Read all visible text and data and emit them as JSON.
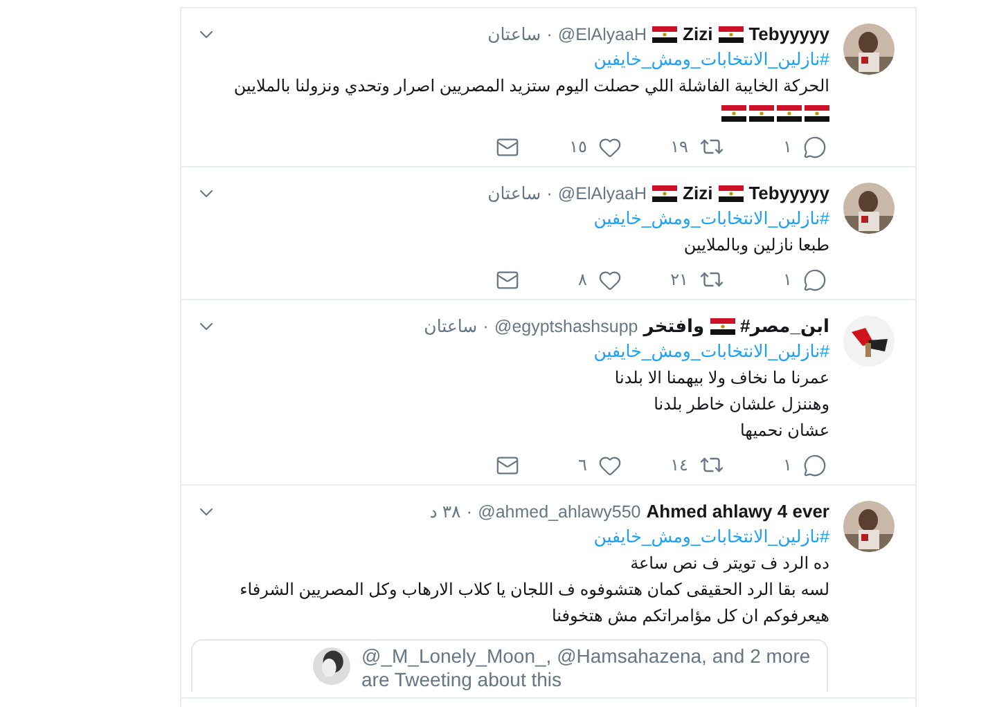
{
  "tweets": [
    {
      "name_parts": [
        {
          "kind": "text",
          "text": "Tebyyyyy"
        },
        {
          "kind": "flag"
        },
        {
          "kind": "text",
          "text": "Zizi"
        },
        {
          "kind": "flag"
        }
      ],
      "handle": "@ElAlyaaH",
      "time": "ساعتان",
      "hashtag": "#نازلين_الانتخابات_ومش_خايفين",
      "lines": [
        {
          "kind": "text",
          "text": "الحركة الخايبة الفاشلة اللي حصلت اليوم ستزيد المصريين اصرار وتحدي ونزولنا بالملايين"
        },
        {
          "kind": "flags",
          "flags": [
            {
              "kind": "egypt"
            },
            {
              "kind": "egypt"
            },
            {
              "kind": "egypt"
            },
            {
              "kind": "egypt"
            }
          ]
        }
      ],
      "separator": "·",
      "replies": "١",
      "retweets": "١٩",
      "likes": "١٥",
      "avatar": {
        "kind": "picture"
      }
    },
    {
      "name_parts": [
        {
          "kind": "text",
          "text": "Tebyyyyy"
        },
        {
          "kind": "flag"
        },
        {
          "kind": "text",
          "text": "Zizi"
        },
        {
          "kind": "flag"
        }
      ],
      "handle": "@ElAlyaaH",
      "time": "ساعتان",
      "hashtag": "#نازلين_الانتخابات_ومش_خايفين",
      "lines": [
        {
          "kind": "text",
          "text": "طبعا نازلين وبالملايين"
        }
      ],
      "separator": "·",
      "replies": "١",
      "retweets": "٢١",
      "likes": "٨",
      "avatar": {
        "kind": "picture"
      }
    },
    {
      "name_parts": [
        {
          "kind": "text",
          "text": "#ابن_مصر"
        },
        {
          "kind": "flag"
        },
        {
          "kind": "text",
          "text": "وافتخر"
        }
      ],
      "handle": "@egyptshashsupp",
      "time": "ساعتان",
      "hashtag": "#نازلين_الانتخابات_ومش_خايفين",
      "lines": [
        {
          "kind": "text",
          "text": "عمرنا ما نخاف ولا بيهمنا الا بلدنا"
        },
        {
          "kind": "text",
          "text": "وهننزل علشان خاطر بلدنا"
        },
        {
          "kind": "text",
          "text": "عشان نحميها"
        }
      ],
      "separator": "·",
      "replies": "١",
      "retweets": "١٤",
      "likes": "٦",
      "avatar": {
        "kind": "logo"
      }
    },
    {
      "name_parts": [
        {
          "kind": "text",
          "text": "Ahmed ahlawy 4 ever"
        }
      ],
      "handle": "@ahmed_ahlawy550",
      "time": "٣٨ د",
      "hashtag": "#نازلين_الانتخابات_ومش_خايفين",
      "lines": [
        {
          "kind": "text",
          "text": "ده الرد ف تويتر ف نص ساعة"
        },
        {
          "kind": "text",
          "text": "لسه بقا الرد الحقيقى كمان هتشوفوه ف اللجان يا كلاب الارهاب وكل المصريين الشرفاء"
        },
        {
          "kind": "text",
          "text": "هيعرفوكم ان كل مؤامراتكم مش هتخوفنا"
        }
      ],
      "separator": "·",
      "avatar": {
        "kind": "picture"
      },
      "card": {
        "text": "@_M_Lonely_Moon_, @Hamsahazena, and 2 more are Tweeting about this"
      }
    }
  ]
}
